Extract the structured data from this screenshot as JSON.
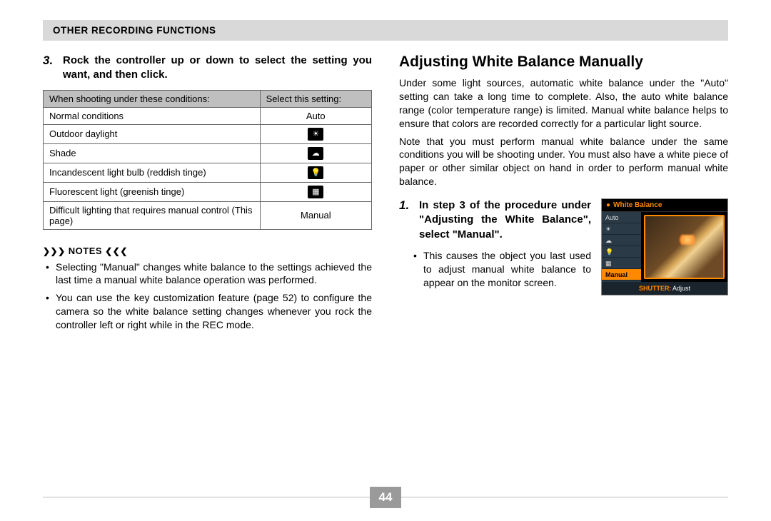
{
  "header": "OTHER RECORDING FUNCTIONS",
  "left": {
    "step_num": "3.",
    "step_text": "Rock the controller up or down to select the setting you want, and then click.",
    "table": {
      "col1_header": "When shooting under these conditions:",
      "col2_header": "Select this setting:",
      "rows": [
        {
          "cond": "Normal conditions",
          "setting": "Auto",
          "is_icon": false
        },
        {
          "cond": "Outdoor daylight",
          "setting": "☀",
          "is_icon": true
        },
        {
          "cond": "Shade",
          "setting": "☁",
          "is_icon": true
        },
        {
          "cond": "Incandescent light bulb (reddish tinge)",
          "setting": "💡",
          "is_icon": true
        },
        {
          "cond": "Fluorescent light (greenish tinge)",
          "setting": "▦",
          "is_icon": true
        },
        {
          "cond": "Difficult lighting that requires manual control (This page)",
          "setting": "Manual",
          "is_icon": false
        }
      ]
    },
    "notes_label": "NOTES",
    "notes": {
      "n0": "Selecting \"Manual\" changes white balance to the settings achieved the last time a manual white balance operation was performed.",
      "n1": "You can use the key customization feature (page 52) to configure the camera so the white balance setting changes whenever you rock the controller left or right while in the REC mode."
    }
  },
  "right": {
    "heading": "Adjusting White Balance Manually",
    "para1": "Under some light sources, automatic white balance under the \"Auto\" setting can take a long time to complete. Also, the auto white balance range (color temperature range) is limited. Manual white balance helps to ensure that colors are recorded correctly for a particular light source.",
    "para2": "Note that you must perform manual white balance under the same conditions you will be shooting under. You must also have a white piece of paper or other similar object on hand in order to perform manual white balance.",
    "step1_num": "1.",
    "step1_text": "In step 3 of the procedure under \"Adjusting the White Balance\", select \"Manual\".",
    "step1_bullet": "This causes the object you last used to adjust manual white balance to appear on the monitor screen."
  },
  "lcd": {
    "title": "White Balance",
    "items": {
      "i0": "Auto",
      "i1": "☀",
      "i2": "☁",
      "i3": "💡",
      "i4": "▦",
      "i5": "Manual"
    },
    "footer_key": "SHUTTER",
    "footer_text": ": Adjust"
  },
  "page_number": "44"
}
